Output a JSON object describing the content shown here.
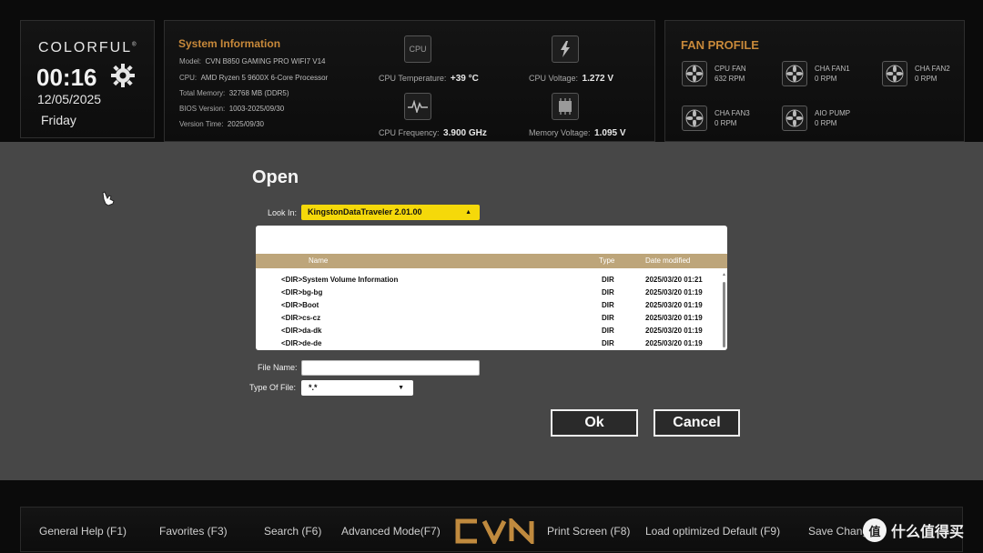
{
  "header": {
    "brand": "COLORFUL",
    "time": "00:16",
    "date": "12/05/2025",
    "day": "Friday"
  },
  "system_info": {
    "title": "System Information",
    "rows": [
      {
        "key": "Model:",
        "value": "CVN B850 GAMING PRO WIFI7 V14"
      },
      {
        "key": "CPU:",
        "value": "AMD Ryzen 5 9600X 6-Core Processor"
      },
      {
        "key": "Total Memory:",
        "value": "32768 MB (DDR5)"
      },
      {
        "key": "BIOS Version:",
        "value": "1003-2025/09/30"
      },
      {
        "key": "Version Time:",
        "value": "2025/09/30"
      }
    ],
    "metrics": [
      {
        "icon": "cpu-icon",
        "icon_text": "CPU",
        "label": "CPU Temperature:",
        "value": "+39 °C"
      },
      {
        "icon": "lightning-icon",
        "label": "CPU Voltage:",
        "value": "1.272 V"
      },
      {
        "icon": "waveform-icon",
        "label": "CPU Frequency:",
        "value": "3.900 GHz"
      },
      {
        "icon": "memory-chip-icon",
        "label": "Memory Voltage:",
        "value": "1.095 V"
      }
    ]
  },
  "fan_profile": {
    "title": "FAN PROFILE",
    "fans": [
      {
        "name": "CPU FAN",
        "rpm": "632 RPM"
      },
      {
        "name": "CHA FAN1",
        "rpm": "0 RPM"
      },
      {
        "name": "CHA FAN2",
        "rpm": "0 RPM"
      },
      {
        "name": "CHA FAN3",
        "rpm": "0 RPM"
      },
      {
        "name": "AIO PUMP",
        "rpm": "0 RPM"
      }
    ]
  },
  "dialog": {
    "title": "Open",
    "look_in_label": "Look In:",
    "look_in_value": "KingstonDataTraveler 2.01.00",
    "columns": {
      "name": "Name",
      "type": "Type",
      "date": "Date modified"
    },
    "files": [
      {
        "name": "<DIR>System Volume Information",
        "type": "DIR",
        "date": "2025/03/20 01:21"
      },
      {
        "name": "<DIR>bg-bg",
        "type": "DIR",
        "date": "2025/03/20 01:19"
      },
      {
        "name": "<DIR>Boot",
        "type": "DIR",
        "date": "2025/03/20 01:19"
      },
      {
        "name": "<DIR>cs-cz",
        "type": "DIR",
        "date": "2025/03/20 01:19"
      },
      {
        "name": "<DIR>da-dk",
        "type": "DIR",
        "date": "2025/03/20 01:19"
      },
      {
        "name": "<DIR>de-de",
        "type": "DIR",
        "date": "2025/03/20 01:19"
      }
    ],
    "file_name_label": "File Name:",
    "file_name_value": "",
    "type_label": "Type Of File:",
    "type_value": "*.*",
    "ok_label": "Ok",
    "cancel_label": "Cancel"
  },
  "bottom_bar": {
    "items": [
      "General Help (F1)",
      "Favorites (F3)",
      "Search (F6)",
      "Advanced Mode(F7)",
      "Print Screen (F8)",
      "Load optimized Default (F9)",
      "Save Chang"
    ],
    "logo": "CVN"
  },
  "watermark": {
    "symbol": "值",
    "text": "什么值得买"
  },
  "colors": {
    "accent": "#c8893a",
    "highlight": "#f5d90a",
    "dialog_bg": "#474747",
    "header_bg": "#bda57a"
  }
}
